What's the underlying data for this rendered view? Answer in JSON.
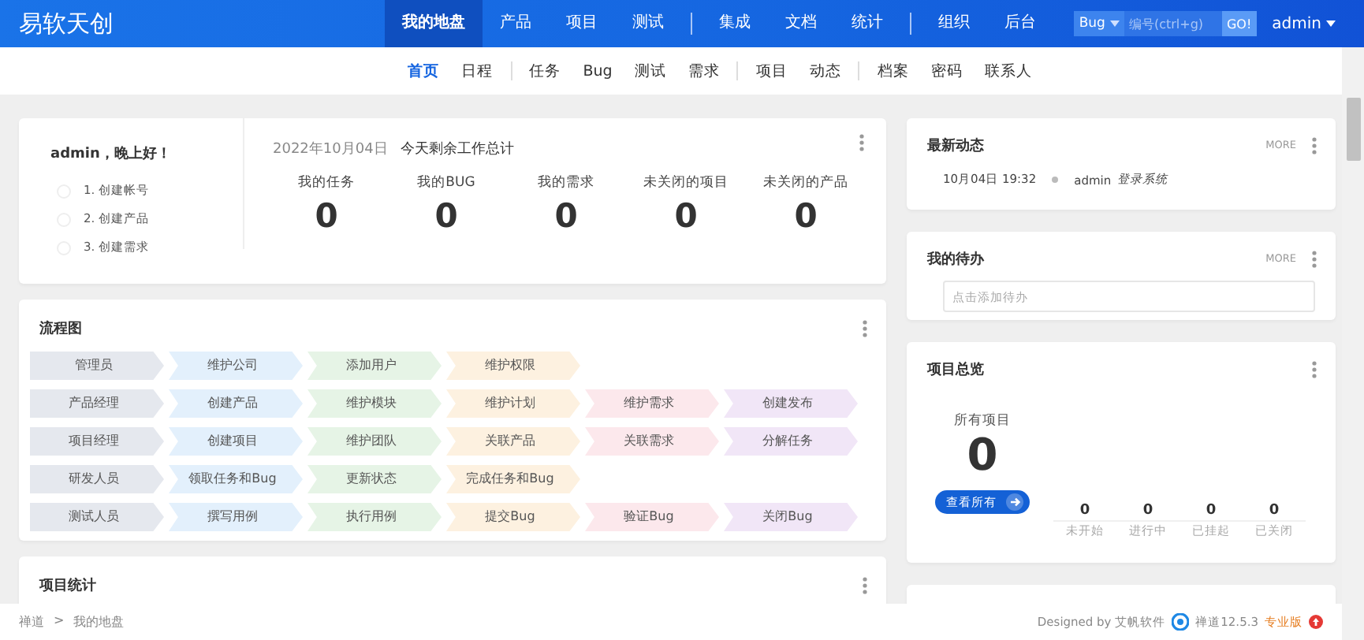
{
  "header": {
    "logo": "易软天创",
    "nav_groups": [
      [
        {
          "label": "我的地盘",
          "selected": true
        },
        {
          "label": "产品",
          "selected": false
        },
        {
          "label": "项目",
          "selected": false
        },
        {
          "label": "测试",
          "selected": false
        }
      ],
      [
        {
          "label": "集成",
          "selected": false
        },
        {
          "label": "文档",
          "selected": false
        },
        {
          "label": "统计",
          "selected": false
        }
      ],
      [
        {
          "label": "组织",
          "selected": false
        },
        {
          "label": "后台",
          "selected": false
        }
      ]
    ],
    "search": {
      "type": "Bug",
      "placeholder": "编号(ctrl+g)",
      "button": "GO!"
    },
    "user": "admin"
  },
  "subnav_groups": [
    [
      {
        "label": "首页",
        "selected": true
      },
      {
        "label": "日程",
        "selected": false
      }
    ],
    [
      {
        "label": "任务",
        "selected": false
      },
      {
        "label": "Bug",
        "selected": false
      },
      {
        "label": "测试",
        "selected": false
      },
      {
        "label": "需求",
        "selected": false
      }
    ],
    [
      {
        "label": "项目",
        "selected": false
      },
      {
        "label": "动态",
        "selected": false
      }
    ],
    [
      {
        "label": "档案",
        "selected": false
      },
      {
        "label": "密码",
        "selected": false
      },
      {
        "label": "联系人",
        "selected": false
      }
    ]
  ],
  "welcome": {
    "greeting": "admin，晚上好！",
    "steps": [
      "1. 创建帐号",
      "2. 创建产品",
      "3. 创建需求"
    ],
    "date": "2022年10月04日",
    "summary": "今天剩余工作总计",
    "stats": [
      {
        "label": "我的任务",
        "value": "0"
      },
      {
        "label": "我的BUG",
        "value": "0"
      },
      {
        "label": "我的需求",
        "value": "0"
      },
      {
        "label": "未关闭的项目",
        "value": "0"
      },
      {
        "label": "未关闭的产品",
        "value": "0"
      }
    ]
  },
  "flow": {
    "title": "流程图",
    "rows": [
      {
        "role": "管理员",
        "steps": [
          {
            "label": "维护公司",
            "color": "#e3f0fc"
          },
          {
            "label": "添加用户",
            "color": "#e6f4e6"
          },
          {
            "label": "维护权限",
            "color": "#fdf1e0"
          }
        ]
      },
      {
        "role": "产品经理",
        "steps": [
          {
            "label": "创建产品",
            "color": "#e3f0fc"
          },
          {
            "label": "维护模块",
            "color": "#e6f4e6"
          },
          {
            "label": "维护计划",
            "color": "#fdf1e0"
          },
          {
            "label": "维护需求",
            "color": "#fce8ec"
          },
          {
            "label": "创建发布",
            "color": "#f1e6f7"
          }
        ]
      },
      {
        "role": "项目经理",
        "steps": [
          {
            "label": "创建项目",
            "color": "#e3f0fc"
          },
          {
            "label": "维护团队",
            "color": "#e6f4e6"
          },
          {
            "label": "关联产品",
            "color": "#fdf1e0"
          },
          {
            "label": "关联需求",
            "color": "#fce8ec"
          },
          {
            "label": "分解任务",
            "color": "#f1e6f7"
          }
        ]
      },
      {
        "role": "研发人员",
        "steps": [
          {
            "label": "领取任务和Bug",
            "color": "#e3f0fc"
          },
          {
            "label": "更新状态",
            "color": "#e6f4e6"
          },
          {
            "label": "完成任务和Bug",
            "color": "#fdf1e0"
          }
        ]
      },
      {
        "role": "测试人员",
        "steps": [
          {
            "label": "撰写用例",
            "color": "#e3f0fc"
          },
          {
            "label": "执行用例",
            "color": "#e6f4e6"
          },
          {
            "label": "提交Bug",
            "color": "#fdf1e0"
          },
          {
            "label": "验证Bug",
            "color": "#fce8ec"
          },
          {
            "label": "关闭Bug",
            "color": "#f1e6f7"
          }
        ]
      }
    ]
  },
  "project_stats": {
    "title": "项目统计"
  },
  "dynamics": {
    "title": "最新动态",
    "more": "MORE",
    "items": [
      {
        "time": "10月04日 19:32",
        "user": "admin",
        "action": "登录系统"
      }
    ]
  },
  "todo": {
    "title": "我的待办",
    "more": "MORE",
    "placeholder": "点击添加待办"
  },
  "overview": {
    "title": "项目总览",
    "total_label": "所有项目",
    "total": "0",
    "button": "查看所有",
    "stats": [
      {
        "value": "0",
        "label": "未开始"
      },
      {
        "value": "0",
        "label": "进行中"
      },
      {
        "value": "0",
        "label": "已挂起"
      },
      {
        "value": "0",
        "label": "已关闭"
      }
    ]
  },
  "breadcrumb": [
    "禅道",
    "我的地盘"
  ],
  "breadcrumb_separator": ">",
  "footer": {
    "designed": "Designed by 艾帆软件",
    "version": "禅道12.5.3",
    "edition": "专业版"
  }
}
